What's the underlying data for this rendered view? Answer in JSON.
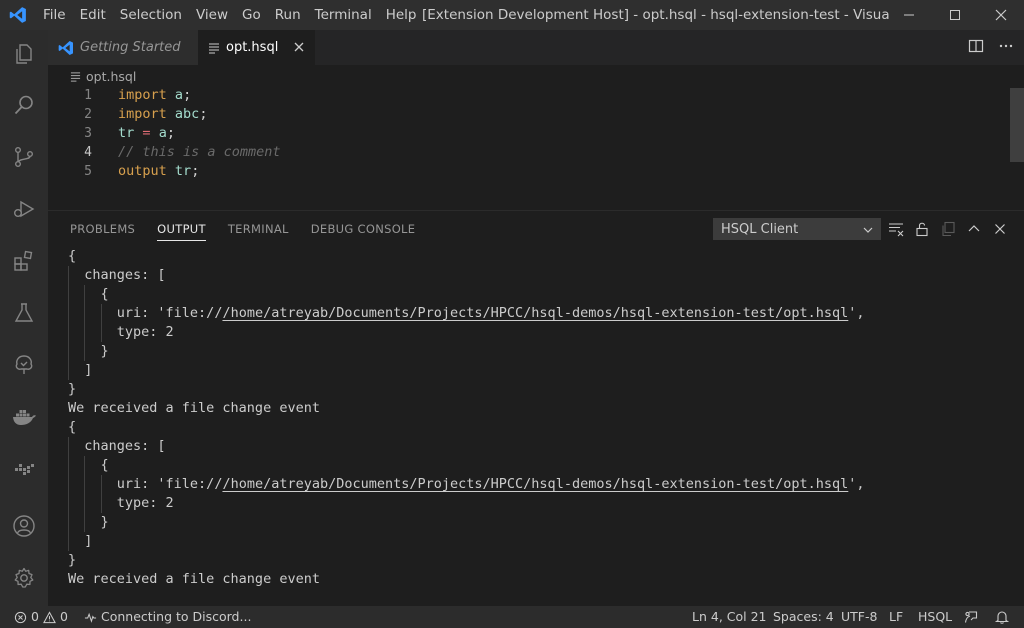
{
  "titlebar": {
    "menu": [
      "File",
      "Edit",
      "Selection",
      "View",
      "Go",
      "Run",
      "Terminal",
      "Help"
    ],
    "title": "[Extension Development Host] - opt.hsql - hsql-extension-test - Visual Stud..."
  },
  "activity_bar": {
    "items": [
      "files-icon",
      "search-icon",
      "source-control-icon",
      "run-debug-icon",
      "extensions-icon",
      "testing-icon",
      "tree-icon",
      "docker-icon",
      "live-share-icon",
      "account-icon",
      "settings-gear-icon"
    ]
  },
  "tabs": [
    {
      "label": "Getting Started",
      "active": false
    },
    {
      "label": "opt.hsql",
      "active": true
    }
  ],
  "breadcrumb": {
    "file": "opt.hsql"
  },
  "editor": {
    "lines": [
      {
        "num": "1",
        "tokens": [
          {
            "t": "import",
            "c": "kw"
          },
          {
            "t": " ",
            "c": "pn"
          },
          {
            "t": "a",
            "c": "id"
          },
          {
            "t": ";",
            "c": "pn"
          }
        ]
      },
      {
        "num": "2",
        "tokens": [
          {
            "t": "import",
            "c": "kw"
          },
          {
            "t": " ",
            "c": "pn"
          },
          {
            "t": "abc",
            "c": "id"
          },
          {
            "t": ";",
            "c": "pn"
          }
        ]
      },
      {
        "num": "3",
        "tokens": [
          {
            "t": "tr",
            "c": "id"
          },
          {
            "t": " ",
            "c": "pn"
          },
          {
            "t": "=",
            "c": "op"
          },
          {
            "t": " ",
            "c": "pn"
          },
          {
            "t": "a",
            "c": "id"
          },
          {
            "t": ";",
            "c": "pn"
          }
        ]
      },
      {
        "num": "4",
        "tokens": [
          {
            "t": "// this is a comment",
            "c": "cm"
          }
        ],
        "active": true
      },
      {
        "num": "5",
        "tokens": [
          {
            "t": "output",
            "c": "kw"
          },
          {
            "t": " ",
            "c": "pn"
          },
          {
            "t": "tr",
            "c": "id"
          },
          {
            "t": ";",
            "c": "pn"
          }
        ]
      }
    ]
  },
  "panel": {
    "tabs": [
      {
        "label": "PROBLEMS",
        "active": false
      },
      {
        "label": "OUTPUT",
        "active": true
      },
      {
        "label": "TERMINAL",
        "active": false
      },
      {
        "label": "DEBUG CONSOLE",
        "active": false
      }
    ],
    "channel": "HSQL Client",
    "output_lines": [
      {
        "indent": 0,
        "text": "{"
      },
      {
        "indent": 2,
        "text": "changes: ["
      },
      {
        "indent": 4,
        "text": "{"
      },
      {
        "indent": 6,
        "pre": "uri: 'file://",
        "link": "/home/atreyab/Documents/Projects/HPCC/hsql-demos/hsql-extension-test/opt.hsql",
        "post": "',"
      },
      {
        "indent": 6,
        "text": "type: 2"
      },
      {
        "indent": 4,
        "text": "}"
      },
      {
        "indent": 2,
        "text": "]"
      },
      {
        "indent": 0,
        "text": "}"
      },
      {
        "indent": 0,
        "text": "We received a file change event"
      },
      {
        "indent": 0,
        "text": "{"
      },
      {
        "indent": 2,
        "text": "changes: ["
      },
      {
        "indent": 4,
        "text": "{"
      },
      {
        "indent": 6,
        "pre": "uri: 'file://",
        "link": "/home/atreyab/Documents/Projects/HPCC/hsql-demos/hsql-extension-test/opt.hsql",
        "post": "',"
      },
      {
        "indent": 6,
        "text": "type: 2"
      },
      {
        "indent": 4,
        "text": "}"
      },
      {
        "indent": 2,
        "text": "]"
      },
      {
        "indent": 0,
        "text": "}"
      },
      {
        "indent": 0,
        "text": "We received a file change event"
      }
    ]
  },
  "statusbar": {
    "errors": "0",
    "warnings": "0",
    "discord": "Connecting to Discord...",
    "position": "Ln 4, Col 21",
    "spaces": "Spaces: 4",
    "encoding": "UTF-8",
    "eol": "LF",
    "language": "HSQL"
  },
  "colors": {
    "accent": "#3794ff",
    "keyword": "#d7a04e",
    "identifier": "#a4dccd",
    "operator": "#e06c75",
    "comment": "#6a6a6a"
  }
}
